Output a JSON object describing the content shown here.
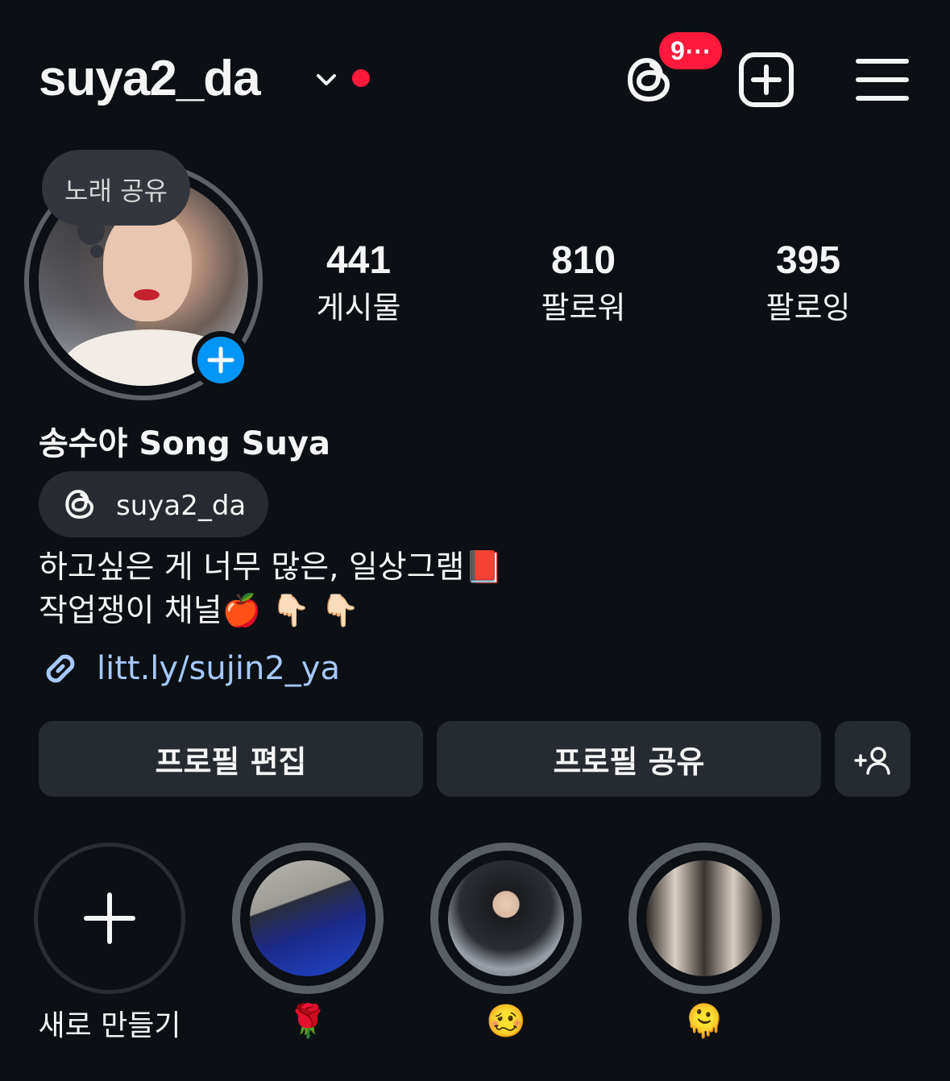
{
  "header": {
    "username": "suya2_da",
    "notification_count": "9⋯"
  },
  "profile": {
    "note": "노래 공유",
    "stats": [
      {
        "value": "441",
        "label": "게시물"
      },
      {
        "value": "810",
        "label": "팔로워"
      },
      {
        "value": "395",
        "label": "팔로잉"
      }
    ],
    "full_name": "송수야 Song Suya",
    "threads_handle": "suya2_da",
    "bio": "하고싶은 게 너무 많은, 일상그램📕\n작업쟁이 채널🍎 👇🏻 👇🏻",
    "link": "litt.ly/sujin2_ya"
  },
  "actions": {
    "edit_label": "프로필 편집",
    "share_label": "프로필 공유",
    "suggest_label": "+👤"
  },
  "highlights": [
    {
      "label": "새로 만들기",
      "type": "new"
    },
    {
      "label": "🌹",
      "type": "highlight"
    },
    {
      "label": "🥴",
      "type": "highlight"
    },
    {
      "label": "🫠",
      "type": "highlight"
    }
  ],
  "colors": {
    "background": "#0c1014",
    "badge": "#ff1a3d",
    "accent_blue": "#0095f6",
    "link": "#a6c9ff",
    "button": "#262a31"
  },
  "icons": [
    "chevron-down-icon",
    "threads-icon",
    "new-post-icon",
    "menu-icon",
    "plus-icon",
    "link-icon",
    "add-person-icon"
  ]
}
